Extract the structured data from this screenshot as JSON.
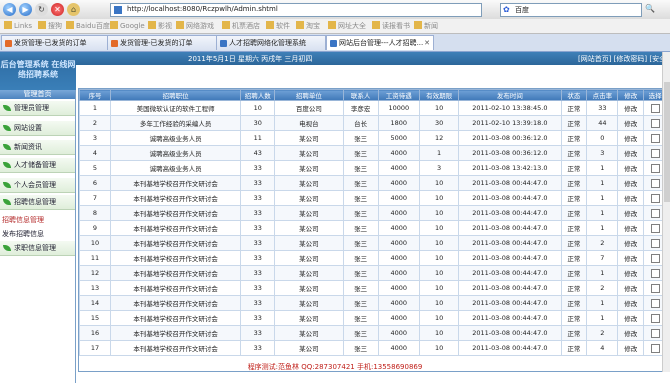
{
  "browser": {
    "address": "http://localhost:8080/Rczpwlh/Admin.shtml",
    "search_placeholder": "百度",
    "bookmarks": [
      "Links",
      "搜狗",
      "Baidu百度",
      "Google",
      "影视",
      "网络游戏",
      "机票酒店",
      "软件",
      "淘宝",
      "网址大全",
      "读报看书",
      "新闻"
    ]
  },
  "tabs": [
    {
      "label": "发货管理-已发货的订单"
    },
    {
      "label": "发货管理-已发货的订单"
    },
    {
      "label": "人才招聘网络化管理系统"
    },
    {
      "label": "网站后台管理---人才招聘..."
    }
  ],
  "header": {
    "date": "2011年5月1日 星期六 丙戌年 三月初四",
    "links": "[网站首页] [修改密码] [安全退出]",
    "logo": "后台管理系统 在线网络招聘系统"
  },
  "sidebar": {
    "title": "管理首页",
    "items": [
      "管理员管理",
      "网站设置",
      "新闻资讯",
      "人才储备管理",
      "个人会员管理",
      "招聘信息管理"
    ],
    "sub_links": [
      "招聘信息管理",
      "发布招聘信息"
    ],
    "last_item": "求职信息管理"
  },
  "table": {
    "headers": [
      "序号",
      "招聘职位",
      "招聘人数",
      "招聘单位",
      "联系人",
      "工资待遇",
      "有效期限",
      "发布时间",
      "状态",
      "点击率",
      "修改",
      "选择"
    ],
    "rows": [
      [
        "1",
        "美国微软认证的软件工程师",
        "10",
        "百度公司",
        "李彦宏",
        "10000",
        "10",
        "2011-02-10 13:38:45.0",
        "正常",
        "33",
        "修改"
      ],
      [
        "2",
        "多年工作经验的采编人员",
        "30",
        "电视台",
        "台长",
        "1800",
        "30",
        "2011-02-10 13:39:18.0",
        "正常",
        "44",
        "修改"
      ],
      [
        "3",
        "诚聘高级业务人员",
        "11",
        "某公司",
        "张三",
        "5000",
        "12",
        "2011-03-08 00:36:12.0",
        "正常",
        "0",
        "修改"
      ],
      [
        "4",
        "诚聘高级业务人员",
        "43",
        "某公司",
        "张三",
        "4000",
        "1",
        "2011-03-08 00:36:12.0",
        "正常",
        "3",
        "修改"
      ],
      [
        "5",
        "诚聘高级业务人员",
        "33",
        "某公司",
        "张三",
        "4000",
        "3",
        "2011-03-08 13:42:13.0",
        "正常",
        "1",
        "修改"
      ],
      [
        "6",
        "本刊基地学校召开作文研讨会",
        "33",
        "某公司",
        "张三",
        "4000",
        "10",
        "2011-03-08 00:44:47.0",
        "正常",
        "1",
        "修改"
      ],
      [
        "7",
        "本刊基地学校召开作文研讨会",
        "33",
        "某公司",
        "张三",
        "4000",
        "10",
        "2011-03-08 00:44:47.0",
        "正常",
        "1",
        "修改"
      ],
      [
        "8",
        "本刊基地学校召开作文研讨会",
        "33",
        "某公司",
        "张三",
        "4000",
        "10",
        "2011-03-08 00:44:47.0",
        "正常",
        "1",
        "修改"
      ],
      [
        "9",
        "本刊基地学校召开作文研讨会",
        "33",
        "某公司",
        "张三",
        "4000",
        "10",
        "2011-03-08 00:44:47.0",
        "正常",
        "1",
        "修改"
      ],
      [
        "10",
        "本刊基地学校召开作文研讨会",
        "33",
        "某公司",
        "张三",
        "4000",
        "10",
        "2011-03-08 00:44:47.0",
        "正常",
        "2",
        "修改"
      ],
      [
        "11",
        "本刊基地学校召开作文研讨会",
        "33",
        "某公司",
        "张三",
        "4000",
        "10",
        "2011-03-08 00:44:47.0",
        "正常",
        "7",
        "修改"
      ],
      [
        "12",
        "本刊基地学校召开作文研讨会",
        "33",
        "某公司",
        "张三",
        "4000",
        "10",
        "2011-03-08 00:44:47.0",
        "正常",
        "1",
        "修改"
      ],
      [
        "13",
        "本刊基地学校召开作文研讨会",
        "33",
        "某公司",
        "张三",
        "4000",
        "10",
        "2011-03-08 00:44:47.0",
        "正常",
        "2",
        "修改"
      ],
      [
        "14",
        "本刊基地学校召开作文研讨会",
        "33",
        "某公司",
        "张三",
        "4000",
        "10",
        "2011-03-08 00:44:47.0",
        "正常",
        "1",
        "修改"
      ],
      [
        "15",
        "本刊基地学校召开作文研讨会",
        "33",
        "某公司",
        "张三",
        "4000",
        "10",
        "2011-03-08 00:44:47.0",
        "正常",
        "1",
        "修改"
      ],
      [
        "16",
        "本刊基地学校召开作文研讨会",
        "33",
        "某公司",
        "张三",
        "4000",
        "10",
        "2011-03-08 00:44:47.0",
        "正常",
        "2",
        "修改"
      ],
      [
        "17",
        "本刊基地学校召开作文研讨会",
        "33",
        "某公司",
        "张三",
        "4000",
        "10",
        "2011-03-08 00:44:47.0",
        "正常",
        "4",
        "修改"
      ]
    ]
  },
  "footer": "程序测试:范鱼林  QQ:287307421  手机:13558690869"
}
